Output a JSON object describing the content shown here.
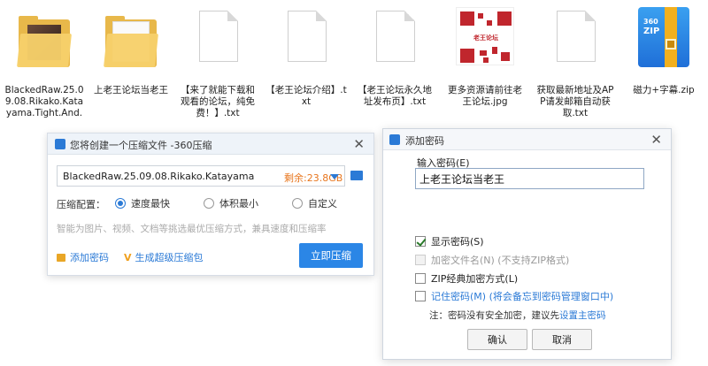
{
  "files": [
    {
      "kind": "folder-photo",
      "name": "BlackedRaw.25.09.08.Rikako.Katayama.Tight.And.Tiny.Cutie.H"
    },
    {
      "kind": "folder",
      "name": "上老王论坛当老王"
    },
    {
      "kind": "txt",
      "name": "【来了就能下载和观看的论坛，纯免费！】.txt"
    },
    {
      "kind": "txt",
      "name": "【老王论坛介绍】.txt"
    },
    {
      "kind": "txt",
      "name": "【老王论坛永久地址发布页】.txt"
    },
    {
      "kind": "image-qr",
      "name": "更多资源请前往老王论坛.jpg",
      "qr_label": "老王论坛"
    },
    {
      "kind": "txt",
      "name": "获取最新地址及APP请发邮箱自动获取.txt"
    },
    {
      "kind": "zip",
      "name": "磁力+字幕.zip",
      "icon_text_top": "360",
      "icon_text_bottom": "ZIP"
    }
  ],
  "compress_dialog": {
    "title": "您将创建一个压缩文件 -360压缩",
    "path": "BlackedRaw.25.09.08.Rikako.Katayama.Tig",
    "free_space": "剩余:23.8GB",
    "config_label": "压缩配置：",
    "options": [
      {
        "label": "速度最快",
        "selected": true
      },
      {
        "label": "体积最小",
        "selected": false
      },
      {
        "label": "自定义",
        "selected": false
      }
    ],
    "hint": "智能为图片、视频、文档等挑选最优压缩方式，兼具速度和压缩率",
    "add_password": "添加密码",
    "super_zip": "生成超级压缩包",
    "compress_button": "立即压缩"
  },
  "password_dialog": {
    "title": "添加密码",
    "input_label": "输入密码(E)",
    "password_value": "上老王论坛当老王",
    "checks": [
      {
        "label": "显示密码(S)",
        "checked": true,
        "disabled": false,
        "style": "normal"
      },
      {
        "label": "加密文件名(N) (不支持ZIP格式)",
        "checked": false,
        "disabled": true,
        "style": "normal"
      },
      {
        "label": "ZIP经典加密方式(L)",
        "checked": false,
        "disabled": false,
        "style": "normal"
      },
      {
        "label": "记住密码(M) (将会备忘到密码管理窗口中)",
        "checked": false,
        "disabled": false,
        "style": "blue"
      }
    ],
    "note_prefix": "注：密码没有安全加密，建议先",
    "note_link": "设置主密码",
    "ok_button": "确认",
    "cancel_button": "取消"
  },
  "colors": {
    "accent": "#2b86e6",
    "link": "#2b7ad6",
    "free_space": "#e8761e"
  }
}
